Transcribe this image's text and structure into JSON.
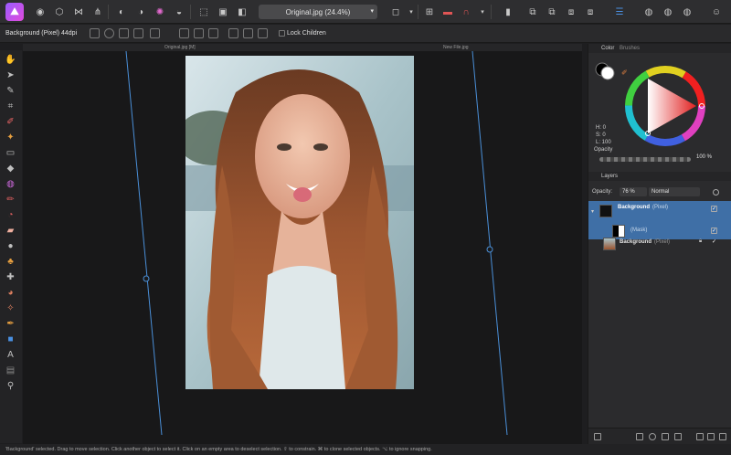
{
  "toolbar": {
    "app_logo": "affinity-photo-logo",
    "document_selector": "Original.jpg (24.4%)",
    "document_selector_icon": "chevron-down-icon"
  },
  "context_toolbar": {
    "layer_name": "Background (Pixel)",
    "dpi": "44dpi",
    "lock_children_label": "Lock Children",
    "lock_children_checked": false
  },
  "canvas": {
    "tabs": [
      {
        "label": "Original.jpg [M]"
      },
      {
        "label": "New File.jpg"
      }
    ]
  },
  "color_panel": {
    "tabs": [
      "Color",
      "Brushes"
    ],
    "readout": {
      "h": "H: 0",
      "s": "S: 0",
      "l": "L: 100"
    },
    "opacity_label": "Opacity",
    "opacity_value": "100 %",
    "primary_color": "#ffffff",
    "secondary_color": "#000000"
  },
  "layers_panel": {
    "title": "Layers",
    "opacity_label": "Opacity:",
    "opacity_value": "76 %",
    "blend_mode": "Normal",
    "layers": [
      {
        "name": "Background",
        "type": "(Pixel)",
        "selected": true,
        "visible": true
      },
      {
        "name": "(Mask)",
        "type": "",
        "selected": true,
        "visible": true
      },
      {
        "name": "Background",
        "type": "(Pixel)",
        "selected": false,
        "visible": true
      }
    ]
  },
  "status_bar": {
    "text": "'Background' selected. Drag to move selection. Click another object to select it. Click on an empty area to deselect selection. ⇧ to constrain. ⌘ to clone selected objects. ⌥ to ignore snapping."
  },
  "colors": {
    "accent_blue": "#3d6ea8",
    "guide_line": "#4a8fd8",
    "selection_highlight": "#3f6fa6"
  }
}
